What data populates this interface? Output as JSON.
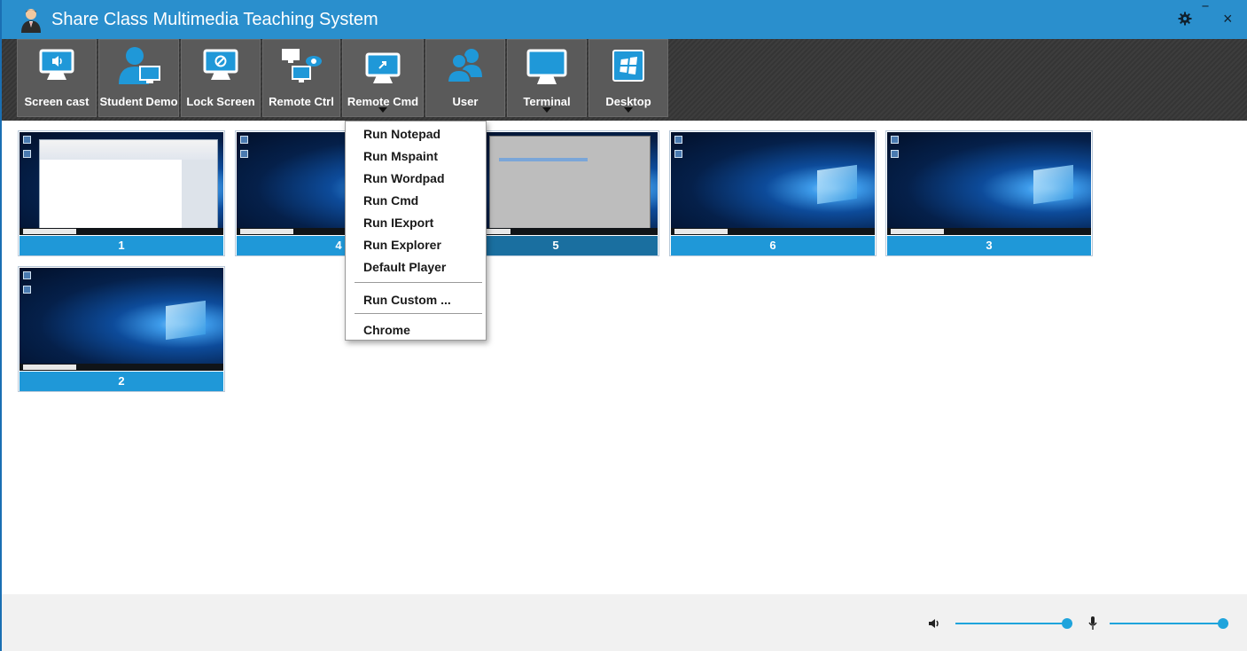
{
  "window": {
    "title": "Share Class Multimedia Teaching System",
    "accent": "#2a8fcd",
    "controls": {
      "settings": "✱",
      "minimize": "‾",
      "close": "×"
    }
  },
  "toolbar": {
    "items": [
      {
        "label": "Screen cast",
        "icon": "screen-cast-icon",
        "has_dropdown": false
      },
      {
        "label": "Student Demo",
        "icon": "student-demo-icon",
        "has_dropdown": false
      },
      {
        "label": "Lock Screen",
        "icon": "lock-screen-icon",
        "has_dropdown": false
      },
      {
        "label": "Remote Ctrl",
        "icon": "remote-ctrl-icon",
        "has_dropdown": false
      },
      {
        "label": "Remote Cmd",
        "icon": "remote-cmd-icon",
        "has_dropdown": true,
        "open": true
      },
      {
        "label": "User",
        "icon": "user-icon",
        "has_dropdown": false
      },
      {
        "label": "Terminal",
        "icon": "terminal-icon",
        "has_dropdown": true
      },
      {
        "label": "Desktop",
        "icon": "desktop-icon",
        "has_dropdown": true
      }
    ]
  },
  "remote_cmd_menu": {
    "items": [
      "Run Notepad",
      "Run Mspaint",
      "Run Wordpad",
      "Run Cmd",
      "Run IExport",
      "Run Explorer",
      "Default Player",
      "Run Custom ...",
      "Chrome"
    ]
  },
  "students": [
    {
      "label": "1",
      "screen": "paint"
    },
    {
      "label": "4",
      "screen": "desktop"
    },
    {
      "label": "5",
      "screen": "gray-window"
    },
    {
      "label": "6",
      "screen": "desktop"
    },
    {
      "label": "3",
      "screen": "desktop"
    },
    {
      "label": "2",
      "screen": "desktop"
    }
  ],
  "bottom": {
    "volume_level": 1.0,
    "mic_level": 1.0,
    "speaker_icon": "speaker-icon",
    "mic_icon": "microphone-icon"
  }
}
